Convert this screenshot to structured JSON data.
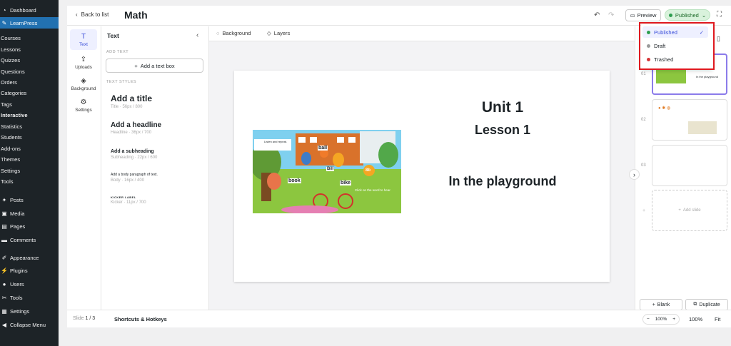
{
  "wp_menu": {
    "top": [
      {
        "label": "Dashboard",
        "icon": "gauge-icon"
      },
      {
        "label": "LearnPress",
        "icon": "learnpress-icon"
      }
    ],
    "learnpress_sub": [
      "Courses",
      "Lessons",
      "Quizzes",
      "Questions",
      "Orders",
      "Categories",
      "Tags",
      "Interactive",
      "Statistics",
      "Students",
      "Add-ons",
      "Themes",
      "Settings",
      "Tools"
    ],
    "bottom": [
      {
        "label": "Posts",
        "icon": "pin-icon"
      },
      {
        "label": "Media",
        "icon": "media-icon"
      },
      {
        "label": "Pages",
        "icon": "page-icon"
      },
      {
        "label": "Comments",
        "icon": "comment-icon"
      },
      {
        "label": "Appearance",
        "icon": "brush-icon"
      },
      {
        "label": "Plugins",
        "icon": "plug-icon"
      },
      {
        "label": "Users",
        "icon": "user-icon"
      },
      {
        "label": "Tools",
        "icon": "wrench-icon"
      },
      {
        "label": "Settings",
        "icon": "sliders-icon"
      },
      {
        "label": "Collapse Menu",
        "icon": "collapse-icon"
      }
    ]
  },
  "topbar": {
    "back": "Back to list",
    "title": "Math",
    "preview": "Preview",
    "status": "Published"
  },
  "rail": [
    "Text",
    "Uploads",
    "Background",
    "Settings"
  ],
  "panel": {
    "title": "Text",
    "add_text": "ADD TEXT",
    "add_box": "Add a text box",
    "text_styles": "TEXT STYLES",
    "styles": [
      {
        "name": "Add a title",
        "meta": "Title · 56px / 800"
      },
      {
        "name": "Add a headline",
        "meta": "Headline · 36px / 700"
      },
      {
        "name": "Add a subheading",
        "meta": "Subheading · 22px / 600"
      },
      {
        "name": "Add a body paragraph of text.",
        "meta": "Body · 16px / 400"
      },
      {
        "name": "KICKER LABEL",
        "meta": "Kicker · 11px / 700"
      }
    ]
  },
  "canvas": {
    "background": "Background",
    "layers": "Layers"
  },
  "slide": {
    "unit": "Unit 1",
    "lesson": "Lesson 1",
    "heading": "In the playground",
    "image_texts": {
      "instruction": "Listen and repeat.",
      "ball": "ball",
      "bill": "Bill",
      "book": "book",
      "bike": "bike",
      "badge": "8b",
      "hint": "Click on the word to hear."
    }
  },
  "slides_panel": {
    "numbers": [
      "01",
      "02",
      "03"
    ],
    "thumb1": "In the playground",
    "add_slide": "Add slide",
    "blank": "Blank",
    "duplicate": "Duplicate"
  },
  "bottom": {
    "slide_label": "Slide",
    "slide_pos": "1 / 3",
    "shortcuts": "Shortcuts & Hotkeys",
    "zoom": "100%",
    "zoom2": "100%",
    "fit": "Fit"
  },
  "status_menu": [
    {
      "label": "Published",
      "color": "#2e9e4f",
      "selected": true
    },
    {
      "label": "Draft",
      "color": "#9a9a9a",
      "selected": false
    },
    {
      "label": "Trashed",
      "color": "#d63638",
      "selected": false
    }
  ]
}
